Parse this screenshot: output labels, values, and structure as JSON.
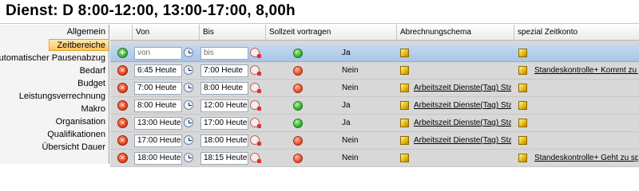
{
  "title": "Dienst: D 8:00-12:00, 13:00-17:00, 8,00h",
  "sidebar": {
    "items": [
      {
        "label": "Allgemein",
        "active": false
      },
      {
        "label": "Zeitbereiche",
        "active": true
      },
      {
        "label": "Automatischer Pausenabzug",
        "active": false
      },
      {
        "label": "Bedarf",
        "active": false
      },
      {
        "label": "Budget",
        "active": false
      },
      {
        "label": "Leistungsverrechnung",
        "active": false
      },
      {
        "label": "Makro",
        "active": false
      },
      {
        "label": "Organisation",
        "active": false
      },
      {
        "label": "Qualifikationen",
        "active": false
      },
      {
        "label": "Übersicht Dauer",
        "active": false
      }
    ]
  },
  "grid": {
    "columns": {
      "von": "Von",
      "bis": "Bis",
      "sollzeit": "Sollzeit vortragen",
      "abrechnung": "Abrechnungschema",
      "zeitkonto": "spezial Zeitkonto"
    },
    "new_row": {
      "von_placeholder": "von",
      "bis_placeholder": "bis",
      "sollzeit": "Ja",
      "sollzeit_color": "green"
    },
    "rows": [
      {
        "von": "6:45 Heute",
        "bis": "7:00 Heute",
        "sollzeit": "Nein",
        "sollzeit_color": "red",
        "abrechnung": "",
        "zeitkonto": "Standeskontrolle+ Kommt zu früh"
      },
      {
        "von": "7:00 Heute",
        "bis": "8:00 Heute",
        "sollzeit": "Nein",
        "sollzeit_color": "red",
        "abrechnung": "Arbeitszeit Dienste(Tag) Standa",
        "zeitkonto": ""
      },
      {
        "von": "8:00 Heute",
        "bis": "12:00 Heute",
        "sollzeit": "Ja",
        "sollzeit_color": "green",
        "abrechnung": "Arbeitszeit Dienste(Tag) Standa",
        "zeitkonto": ""
      },
      {
        "von": "13:00 Heute",
        "bis": "17:00 Heute",
        "sollzeit": "Ja",
        "sollzeit_color": "green",
        "abrechnung": "Arbeitszeit Dienste(Tag) Standa",
        "zeitkonto": ""
      },
      {
        "von": "17:00 Heute",
        "bis": "18:00 Heute",
        "sollzeit": "Nein",
        "sollzeit_color": "red",
        "abrechnung": "Arbeitszeit Dienste(Tag) Standa",
        "zeitkonto": ""
      },
      {
        "von": "18:00 Heute",
        "bis": "18:15 Heute",
        "sollzeit": "Nein",
        "sollzeit_color": "red",
        "abrechnung": "",
        "zeitkonto": "Standeskontrolle+ Geht zu spät"
      }
    ]
  },
  "icons": {
    "add": "add-circle-icon",
    "delete": "delete-circle-icon",
    "clock": "clock-icon",
    "clock_clear": "clock-clear-icon",
    "cube": "cube-icon",
    "status_green": "#2aa52a",
    "status_red": "#e2442a"
  }
}
